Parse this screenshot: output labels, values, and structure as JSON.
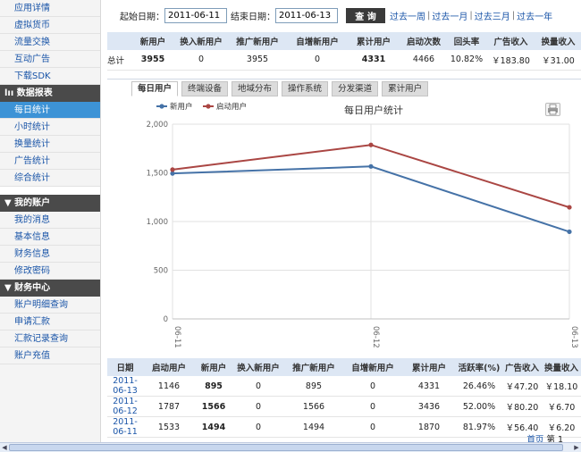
{
  "sidebar": {
    "group1": [
      "应用详情",
      "虚拟货币",
      "流量交换",
      "互动广告",
      "下载SDK"
    ],
    "reports_title": "lıı 数据报表",
    "reports": [
      "每日统计",
      "小时统计",
      "换量统计",
      "广告统计",
      "综合统计"
    ],
    "account_title": "▼ 我的账户",
    "account": [
      "我的消息",
      "基本信息",
      "财务信息",
      "修改密码"
    ],
    "finance_title": "▼ 财务中心",
    "finance": [
      "账户明细查询",
      "申请汇款",
      "汇款记录查询",
      "账户充值"
    ]
  },
  "datebar": {
    "start_label": "起始日期：",
    "start_value": "2011-06-11",
    "end_label": "结束日期：",
    "end_value": "2011-06-13",
    "query_label": "查 询",
    "links": [
      "过去一周",
      "过去一月",
      "过去三月",
      "过去一年"
    ]
  },
  "summary": {
    "headers": [
      "",
      "新用户",
      "换入新用户",
      "推广新用户",
      "自增新用户",
      "累计用户",
      "启动次数",
      "回头率",
      "广告收入",
      "换量收入"
    ],
    "row": [
      "总计",
      "3955",
      "0",
      "3955",
      "0",
      "4331",
      "4466",
      "10.82%",
      "￥183.80",
      "￥31.00"
    ]
  },
  "tabs": [
    "每日用户",
    "终端设备",
    "地域分布",
    "操作系统",
    "分发渠道",
    "累计用户"
  ],
  "chart_data": {
    "type": "line",
    "title": "每日用户统计",
    "categories": [
      "06-11",
      "06-12",
      "06-13"
    ],
    "series": [
      {
        "name": "新用户",
        "values": [
          1494,
          1566,
          895
        ],
        "color": "#4572a7"
      },
      {
        "name": "启动用户",
        "values": [
          1533,
          1787,
          1146
        ],
        "color": "#aa4643"
      }
    ],
    "ylim": [
      0,
      2000
    ],
    "yticks": [
      "0",
      "500",
      "1,000",
      "1,500",
      "2,000"
    ],
    "grid": true,
    "legend": "top-left"
  },
  "detail": {
    "headers": [
      "日期",
      "启动用户",
      "新用户",
      "换入新用户",
      "推广新用户",
      "自增新用户",
      "累计用户",
      "活跃率(%)",
      "广告收入",
      "换量收入"
    ],
    "rows": [
      [
        "2011-06-13",
        "1146",
        "895",
        "0",
        "895",
        "0",
        "4331",
        "26.46%",
        "￥47.20",
        "￥18.10"
      ],
      [
        "2011-06-12",
        "1787",
        "1566",
        "0",
        "1566",
        "0",
        "3436",
        "52.00%",
        "￥80.20",
        "￥6.70"
      ],
      [
        "2011-06-11",
        "1533",
        "1494",
        "0",
        "1494",
        "0",
        "1870",
        "81.97%",
        "￥56.40",
        "￥6.20"
      ]
    ]
  },
  "pager": {
    "first": "首页",
    "page_label": "第",
    "page": "1"
  }
}
